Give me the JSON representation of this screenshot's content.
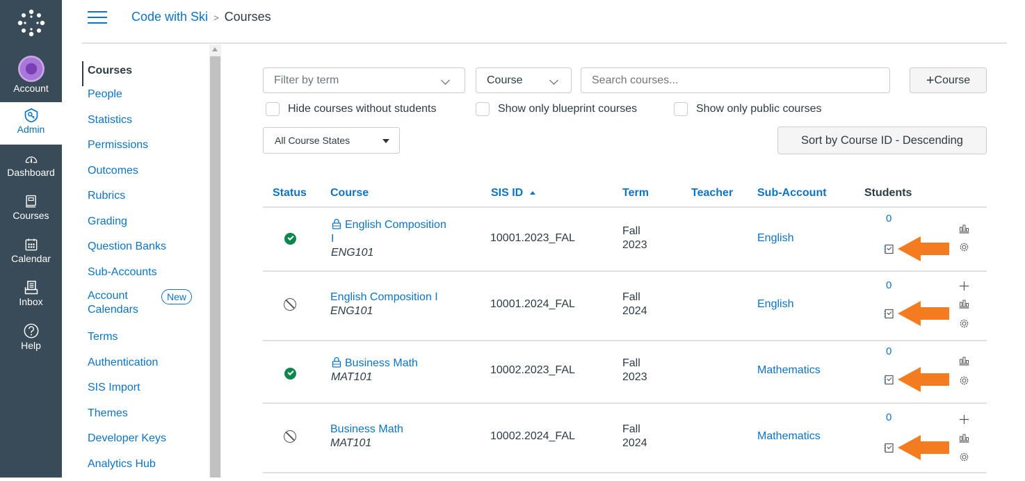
{
  "global_nav": {
    "items": [
      {
        "label": "Account",
        "icon": "user-avatar-icon"
      },
      {
        "label": "Admin",
        "icon": "shield-key-icon",
        "active": true
      },
      {
        "label": "Dashboard",
        "icon": "speedometer-icon"
      },
      {
        "label": "Courses",
        "icon": "book-icon"
      },
      {
        "label": "Calendar",
        "icon": "calendar-icon"
      },
      {
        "label": "Inbox",
        "icon": "inbox-icon"
      },
      {
        "label": "Help",
        "icon": "question-circle-icon"
      }
    ]
  },
  "header": {
    "breadcrumb": [
      {
        "label": "Code with Ski",
        "link": true
      },
      {
        "label": "Courses",
        "link": false
      }
    ],
    "separator": ">"
  },
  "account_nav": {
    "items": [
      {
        "label": "Courses",
        "active": true
      },
      {
        "label": "People"
      },
      {
        "label": "Statistics"
      },
      {
        "label": "Permissions"
      },
      {
        "label": "Outcomes"
      },
      {
        "label": "Rubrics"
      },
      {
        "label": "Grading"
      },
      {
        "label": "Question Banks"
      },
      {
        "label": "Sub-Accounts"
      },
      {
        "label": "Account Calendars",
        "line1": "Account",
        "line2": "Calendars",
        "badge": "New"
      },
      {
        "label": "Terms"
      },
      {
        "label": "Authentication"
      },
      {
        "label": "SIS Import"
      },
      {
        "label": "Themes"
      },
      {
        "label": "Developer Keys"
      },
      {
        "label": "Analytics Hub"
      }
    ]
  },
  "filters": {
    "term_placeholder": "Filter by term",
    "search_by": "Course",
    "search_placeholder": "Search courses...",
    "add_course_label": "Course",
    "checkboxes": [
      {
        "label": "Hide courses without students",
        "checked": false
      },
      {
        "label": "Show only blueprint courses",
        "checked": false
      },
      {
        "label": "Show only public courses",
        "checked": false
      }
    ],
    "course_states": "All Course States",
    "sort_label": "Sort by Course ID - Descending"
  },
  "table": {
    "headers": [
      "Status",
      "Course",
      "SIS ID",
      "Term",
      "Teacher",
      "Sub-Account",
      "Students"
    ],
    "sorted_column": "SIS ID",
    "sort_direction": "ascending",
    "rows": [
      {
        "status": "published",
        "locked": true,
        "course": "English Composition I",
        "course_line1": "English Composition",
        "course_line2": "I",
        "code": "ENG101",
        "sis_id": "10001.2023_FAL",
        "term_line1": "Fall",
        "term_line2": "2023",
        "teacher": "",
        "sub_account": "English",
        "students": "0",
        "actions": [
          "statistics",
          "settings"
        ]
      },
      {
        "status": "unpublished",
        "locked": false,
        "course": "English Composition I",
        "code": "ENG101",
        "sis_id": "10001.2024_FAL",
        "term_line1": "Fall",
        "term_line2": "2024",
        "teacher": "",
        "sub_account": "English",
        "students": "0",
        "actions": [
          "add-user",
          "statistics",
          "settings"
        ]
      },
      {
        "status": "published",
        "locked": true,
        "course": "Business Math",
        "code": "MAT101",
        "sis_id": "10002.2023_FAL",
        "term_line1": "Fall",
        "term_line2": "2023",
        "teacher": "",
        "sub_account": "Mathematics",
        "students": "0",
        "actions": [
          "statistics",
          "settings"
        ]
      },
      {
        "status": "unpublished",
        "locked": false,
        "course": "Business Math",
        "code": "MAT101",
        "sis_id": "10002.2024_FAL",
        "term_line1": "Fall",
        "term_line2": "2024",
        "teacher": "",
        "sub_account": "Mathematics",
        "students": "0",
        "actions": [
          "add-user",
          "statistics",
          "settings"
        ]
      }
    ]
  },
  "annotations": {
    "arrow_color": "#f47c20",
    "arrow_target": "gradebook-icon"
  },
  "colors": {
    "link": "#0b74c4",
    "nav_bg": "#394b58",
    "published": "#0b874b"
  }
}
